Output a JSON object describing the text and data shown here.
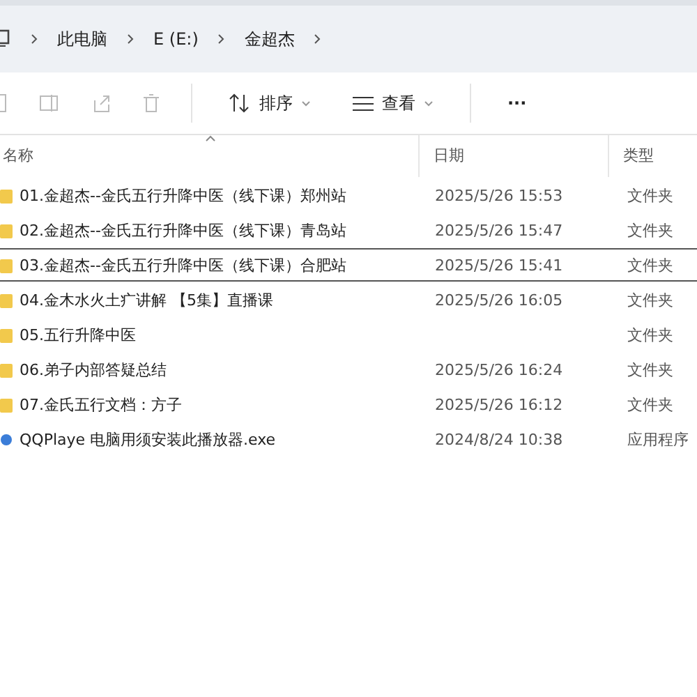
{
  "breadcrumb": [
    "此电脑",
    "E (E:)",
    "金超杰"
  ],
  "toolbar": {
    "sort": "排序",
    "view": "查看",
    "more": "···"
  },
  "columns": [
    "名称",
    "日期",
    "类型"
  ],
  "rows": [
    {
      "name": "01.金超杰--金氏五行升降中医（线下课）郑州站",
      "date": "2025/5/26 15:53",
      "type": "文件夹",
      "kind": "folder",
      "selected": false
    },
    {
      "name": "02.金超杰--金氏五行升降中医（线下课）青岛站",
      "date": "2025/5/26 15:47",
      "type": "文件夹",
      "kind": "folder",
      "selected": false
    },
    {
      "name": "03.金超杰--金氏五行升降中医（线下课）合肥站",
      "date": "2025/5/26 15:41",
      "type": "文件夹",
      "kind": "folder",
      "selected": true
    },
    {
      "name": "04.金木水火土疒讲解 【5集】直播课",
      "date": "2025/5/26 16:05",
      "type": "文件夹",
      "kind": "folder",
      "selected": false
    },
    {
      "name": "05.五行升降中医",
      "type": "文件夹",
      "kind": "folder",
      "selected": false
    },
    {
      "name": "06.弟子内部答疑总结",
      "date": "2025/5/26 16:24",
      "type": "文件夹",
      "kind": "folder",
      "selected": false
    },
    {
      "name": "07.金氏五行文档：方子",
      "date": "2025/5/26 16:12",
      "type": "文件夹",
      "kind": "folder",
      "selected": false
    },
    {
      "name": "QQPlaye 电脑用须安装此播放器.exe",
      "date": "2024/8/24 10:38",
      "type": "应用程序",
      "kind": "app",
      "selected": false
    }
  ]
}
